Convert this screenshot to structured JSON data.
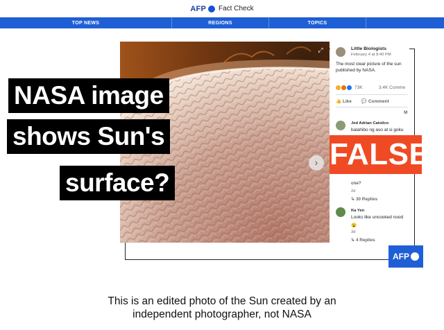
{
  "header": {
    "brand": "AFP",
    "subtitle": "Fact Check"
  },
  "nav": {
    "items": [
      "TOP NEWS",
      "REGIONS",
      "TOPICS"
    ]
  },
  "headline": {
    "lines": [
      "NASA image",
      "shows Sun's",
      "surface?"
    ]
  },
  "verdict": "FALSE",
  "facebook_post": {
    "page_name": "Little Biologists",
    "date": "February 4 at 8:40 PM",
    "text_line1": "The most clear picture of the sun",
    "text_line2": "published by NASA.",
    "reaction_count": "73K",
    "comment_count": "3.4K Comme",
    "like_label": "Like",
    "comment_label": "Comment",
    "more_label": "M",
    "comments": [
      {
        "name": "Jed Adrian Catolico",
        "text": "balahibo ng aso at si goku"
      },
      {
        "text": "one?",
        "age": "2d",
        "replies": "30 Replies"
      },
      {
        "name": "Ka Yen",
        "text": "Looks like uncooked nood",
        "age": "3d",
        "replies": "4 Replies"
      }
    ]
  },
  "logo": {
    "text": "AFP"
  },
  "caption": {
    "line1": "This is an edited photo of the Sun created by an",
    "line2": "independent photographer, not NASA"
  },
  "colors": {
    "nav_blue": "#1f5fd6",
    "false_red": "#f04a24",
    "afp_blue": "#1a3f9b"
  }
}
